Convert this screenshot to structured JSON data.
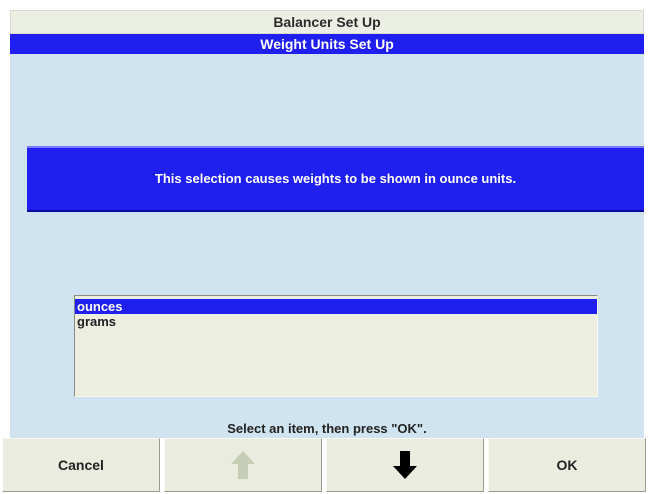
{
  "header": {
    "title": "Balancer Set Up",
    "subtitle": "Weight Units Set Up"
  },
  "message": {
    "text": "This selection causes weights to be shown in ounce units."
  },
  "listbox": {
    "items": [
      {
        "label": "ounces",
        "selected": true
      },
      {
        "label": "grams",
        "selected": false
      }
    ]
  },
  "hint": {
    "text": "Select an item, then press \"OK\"."
  },
  "buttons": {
    "cancel_label": "Cancel",
    "up_icon": "arrow-up-icon",
    "down_icon": "arrow-down-icon",
    "ok_label": "OK",
    "up_enabled": false,
    "down_enabled": true
  },
  "colors": {
    "highlight_blue": "#1f1ff0",
    "panel_background": "#cfe3f0",
    "button_background": "#e9ecdf",
    "disabled_arrow": "#c5cdb6"
  }
}
